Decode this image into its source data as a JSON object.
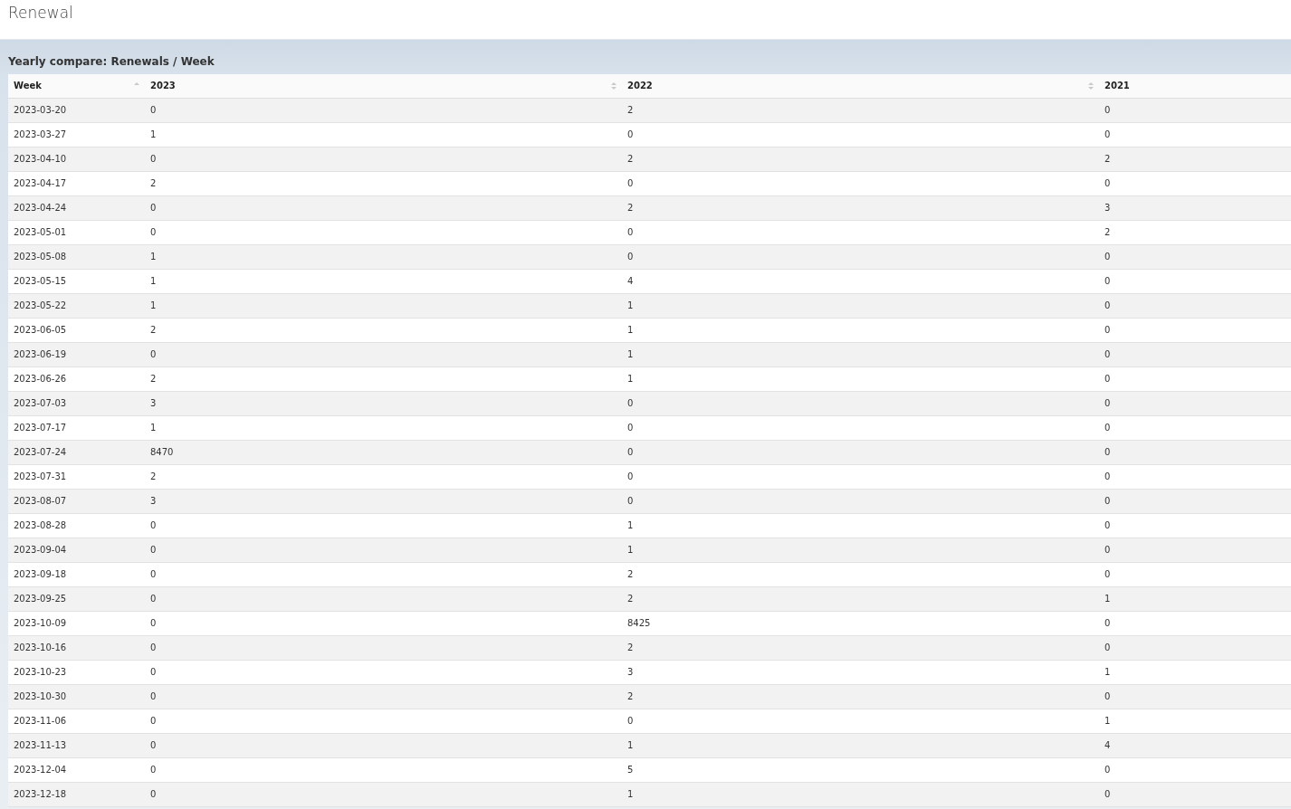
{
  "page": {
    "title": "Renewal"
  },
  "panel": {
    "title": "Yearly compare: Renewals / Week"
  },
  "table": {
    "columns": [
      {
        "label": "Week",
        "sorted": true
      },
      {
        "label": "2023",
        "sorted": false
      },
      {
        "label": "2022",
        "sorted": false
      },
      {
        "label": "2021"
      }
    ],
    "rows": [
      [
        "2023-03-20",
        "0",
        "2",
        "0"
      ],
      [
        "2023-03-27",
        "1",
        "0",
        "0"
      ],
      [
        "2023-04-10",
        "0",
        "2",
        "2"
      ],
      [
        "2023-04-17",
        "2",
        "0",
        "0"
      ],
      [
        "2023-04-24",
        "0",
        "2",
        "3"
      ],
      [
        "2023-05-01",
        "0",
        "0",
        "2"
      ],
      [
        "2023-05-08",
        "1",
        "0",
        "0"
      ],
      [
        "2023-05-15",
        "1",
        "4",
        "0"
      ],
      [
        "2023-05-22",
        "1",
        "1",
        "0"
      ],
      [
        "2023-06-05",
        "2",
        "1",
        "0"
      ],
      [
        "2023-06-19",
        "0",
        "1",
        "0"
      ],
      [
        "2023-06-26",
        "2",
        "1",
        "0"
      ],
      [
        "2023-07-03",
        "3",
        "0",
        "0"
      ],
      [
        "2023-07-17",
        "1",
        "0",
        "0"
      ],
      [
        "2023-07-24",
        "8470",
        "0",
        "0"
      ],
      [
        "2023-07-31",
        "2",
        "0",
        "0"
      ],
      [
        "2023-08-07",
        "3",
        "0",
        "0"
      ],
      [
        "2023-08-28",
        "0",
        "1",
        "0"
      ],
      [
        "2023-09-04",
        "0",
        "1",
        "0"
      ],
      [
        "2023-09-18",
        "0",
        "2",
        "0"
      ],
      [
        "2023-09-25",
        "0",
        "2",
        "1"
      ],
      [
        "2023-10-09",
        "0",
        "8425",
        "0"
      ],
      [
        "2023-10-16",
        "0",
        "2",
        "0"
      ],
      [
        "2023-10-23",
        "0",
        "3",
        "1"
      ],
      [
        "2023-10-30",
        "0",
        "2",
        "0"
      ],
      [
        "2023-11-06",
        "0",
        "0",
        "1"
      ],
      [
        "2023-11-13",
        "0",
        "1",
        "4"
      ],
      [
        "2023-12-04",
        "0",
        "5",
        "0"
      ],
      [
        "2023-12-18",
        "0",
        "1",
        "0"
      ]
    ]
  }
}
